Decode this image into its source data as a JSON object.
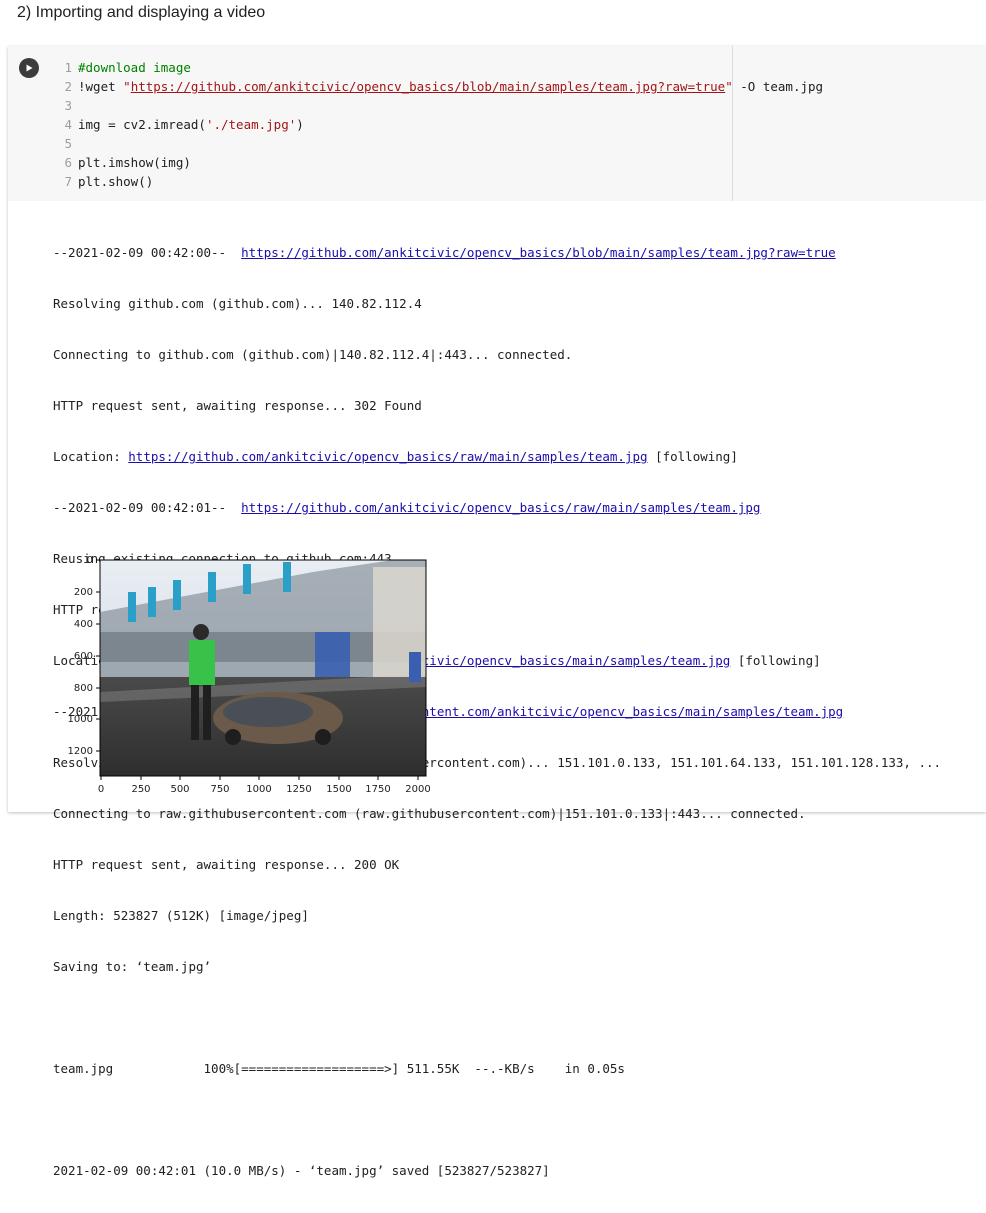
{
  "heading": "2) Importing and displaying a video",
  "code": {
    "line1": {
      "num": "1",
      "comment": "#download image"
    },
    "line2": {
      "num": "2",
      "cmd": "!wget ",
      "quote_open": "\"",
      "url": "https://github.com/ankitcivic/opencv_basics/blob/main/samples/team.jpg?raw=true",
      "quote_close": "\"",
      "rest": " -O team.jpg"
    },
    "line3": {
      "num": "3"
    },
    "line4": {
      "num": "4",
      "pre": "img = cv2.imread(",
      "str": "'./team.jpg'",
      "post": ")"
    },
    "line5": {
      "num": "5"
    },
    "line6": {
      "num": "6",
      "text": "plt.imshow(img)"
    },
    "line7": {
      "num": "7",
      "text": "plt.show()"
    }
  },
  "output": {
    "l1_prefix": "--2021-02-09 00:42:00--  ",
    "l1_link": "https://github.com/ankitcivic/opencv_basics/blob/main/samples/team.jpg?raw=true",
    "l2": "Resolving github.com (github.com)... 140.82.112.4",
    "l3": "Connecting to github.com (github.com)|140.82.112.4|:443... connected.",
    "l4": "HTTP request sent, awaiting response... 302 Found",
    "l5_prefix": "Location: ",
    "l5_link": "https://github.com/ankitcivic/opencv_basics/raw/main/samples/team.jpg",
    "l5_suffix": " [following]",
    "l6_prefix": "--2021-02-09 00:42:01--  ",
    "l6_link": "https://github.com/ankitcivic/opencv_basics/raw/main/samples/team.jpg",
    "l7": "Reusing existing connection to github.com:443.",
    "l8": "HTTP request sent, awaiting response... 302 Found",
    "l9_prefix": "Location: ",
    "l9_link": "https://raw.githubusercontent.com/ankitcivic/opencv_basics/main/samples/team.jpg",
    "l9_suffix": " [following]",
    "l10_prefix": "--2021-02-09 00:42:01--  ",
    "l10_link": "https://raw.githubusercontent.com/ankitcivic/opencv_basics/main/samples/team.jpg",
    "l11": "Resolving raw.githubusercontent.com (raw.githubusercontent.com)... 151.101.0.133, 151.101.64.133, 151.101.128.133, ...",
    "l12": "Connecting to raw.githubusercontent.com (raw.githubusercontent.com)|151.101.0.133|:443... connected.",
    "l13": "HTTP request sent, awaiting response... 200 OK",
    "l14": "Length: 523827 (512K) [image/jpeg]",
    "l15": "Saving to: ‘team.jpg’",
    "l16": "",
    "l17": "team.jpg            100%[===================>] 511.55K  --.-KB/s    in 0.05s",
    "l18": "",
    "l19": "2021-02-09 00:42:01 (10.0 MB/s) - ‘team.jpg’ saved [523827/523827]"
  },
  "plot": {
    "y_ticks": [
      "0",
      "200",
      "400",
      "600",
      "800",
      "1000",
      "1200"
    ],
    "x_ticks": [
      "0",
      "250",
      "500",
      "750",
      "1000",
      "1250",
      "1500",
      "1750",
      "2000"
    ]
  },
  "icons": {
    "run": "play-circle-icon"
  }
}
